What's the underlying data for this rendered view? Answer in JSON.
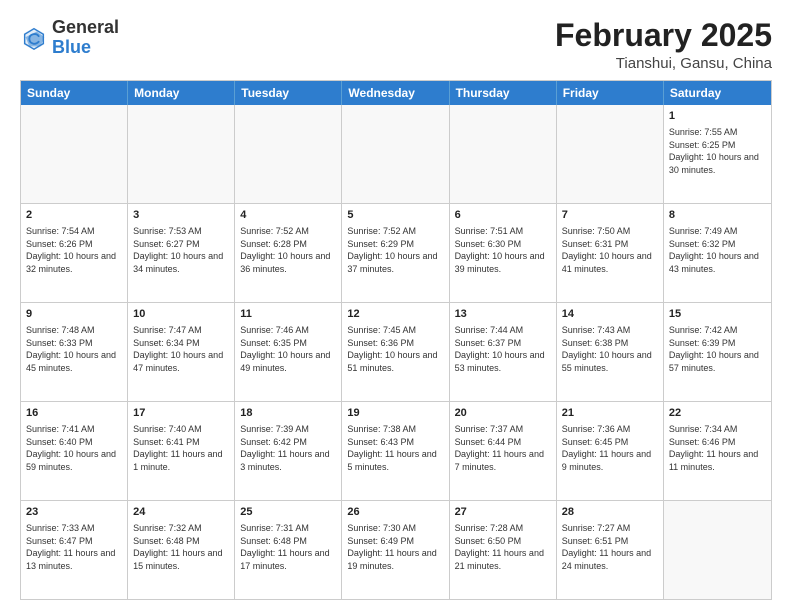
{
  "header": {
    "logo_general": "General",
    "logo_blue": "Blue",
    "month": "February 2025",
    "location": "Tianshui, Gansu, China"
  },
  "calendar": {
    "days_of_week": [
      "Sunday",
      "Monday",
      "Tuesday",
      "Wednesday",
      "Thursday",
      "Friday",
      "Saturday"
    ],
    "rows": [
      [
        {
          "day": "",
          "text": ""
        },
        {
          "day": "",
          "text": ""
        },
        {
          "day": "",
          "text": ""
        },
        {
          "day": "",
          "text": ""
        },
        {
          "day": "",
          "text": ""
        },
        {
          "day": "",
          "text": ""
        },
        {
          "day": "1",
          "text": "Sunrise: 7:55 AM\nSunset: 6:25 PM\nDaylight: 10 hours and 30 minutes."
        }
      ],
      [
        {
          "day": "2",
          "text": "Sunrise: 7:54 AM\nSunset: 6:26 PM\nDaylight: 10 hours and 32 minutes."
        },
        {
          "day": "3",
          "text": "Sunrise: 7:53 AM\nSunset: 6:27 PM\nDaylight: 10 hours and 34 minutes."
        },
        {
          "day": "4",
          "text": "Sunrise: 7:52 AM\nSunset: 6:28 PM\nDaylight: 10 hours and 36 minutes."
        },
        {
          "day": "5",
          "text": "Sunrise: 7:52 AM\nSunset: 6:29 PM\nDaylight: 10 hours and 37 minutes."
        },
        {
          "day": "6",
          "text": "Sunrise: 7:51 AM\nSunset: 6:30 PM\nDaylight: 10 hours and 39 minutes."
        },
        {
          "day": "7",
          "text": "Sunrise: 7:50 AM\nSunset: 6:31 PM\nDaylight: 10 hours and 41 minutes."
        },
        {
          "day": "8",
          "text": "Sunrise: 7:49 AM\nSunset: 6:32 PM\nDaylight: 10 hours and 43 minutes."
        }
      ],
      [
        {
          "day": "9",
          "text": "Sunrise: 7:48 AM\nSunset: 6:33 PM\nDaylight: 10 hours and 45 minutes."
        },
        {
          "day": "10",
          "text": "Sunrise: 7:47 AM\nSunset: 6:34 PM\nDaylight: 10 hours and 47 minutes."
        },
        {
          "day": "11",
          "text": "Sunrise: 7:46 AM\nSunset: 6:35 PM\nDaylight: 10 hours and 49 minutes."
        },
        {
          "day": "12",
          "text": "Sunrise: 7:45 AM\nSunset: 6:36 PM\nDaylight: 10 hours and 51 minutes."
        },
        {
          "day": "13",
          "text": "Sunrise: 7:44 AM\nSunset: 6:37 PM\nDaylight: 10 hours and 53 minutes."
        },
        {
          "day": "14",
          "text": "Sunrise: 7:43 AM\nSunset: 6:38 PM\nDaylight: 10 hours and 55 minutes."
        },
        {
          "day": "15",
          "text": "Sunrise: 7:42 AM\nSunset: 6:39 PM\nDaylight: 10 hours and 57 minutes."
        }
      ],
      [
        {
          "day": "16",
          "text": "Sunrise: 7:41 AM\nSunset: 6:40 PM\nDaylight: 10 hours and 59 minutes."
        },
        {
          "day": "17",
          "text": "Sunrise: 7:40 AM\nSunset: 6:41 PM\nDaylight: 11 hours and 1 minute."
        },
        {
          "day": "18",
          "text": "Sunrise: 7:39 AM\nSunset: 6:42 PM\nDaylight: 11 hours and 3 minutes."
        },
        {
          "day": "19",
          "text": "Sunrise: 7:38 AM\nSunset: 6:43 PM\nDaylight: 11 hours and 5 minutes."
        },
        {
          "day": "20",
          "text": "Sunrise: 7:37 AM\nSunset: 6:44 PM\nDaylight: 11 hours and 7 minutes."
        },
        {
          "day": "21",
          "text": "Sunrise: 7:36 AM\nSunset: 6:45 PM\nDaylight: 11 hours and 9 minutes."
        },
        {
          "day": "22",
          "text": "Sunrise: 7:34 AM\nSunset: 6:46 PM\nDaylight: 11 hours and 11 minutes."
        }
      ],
      [
        {
          "day": "23",
          "text": "Sunrise: 7:33 AM\nSunset: 6:47 PM\nDaylight: 11 hours and 13 minutes."
        },
        {
          "day": "24",
          "text": "Sunrise: 7:32 AM\nSunset: 6:48 PM\nDaylight: 11 hours and 15 minutes."
        },
        {
          "day": "25",
          "text": "Sunrise: 7:31 AM\nSunset: 6:48 PM\nDaylight: 11 hours and 17 minutes."
        },
        {
          "day": "26",
          "text": "Sunrise: 7:30 AM\nSunset: 6:49 PM\nDaylight: 11 hours and 19 minutes."
        },
        {
          "day": "27",
          "text": "Sunrise: 7:28 AM\nSunset: 6:50 PM\nDaylight: 11 hours and 21 minutes."
        },
        {
          "day": "28",
          "text": "Sunrise: 7:27 AM\nSunset: 6:51 PM\nDaylight: 11 hours and 24 minutes."
        },
        {
          "day": "",
          "text": ""
        }
      ]
    ]
  }
}
